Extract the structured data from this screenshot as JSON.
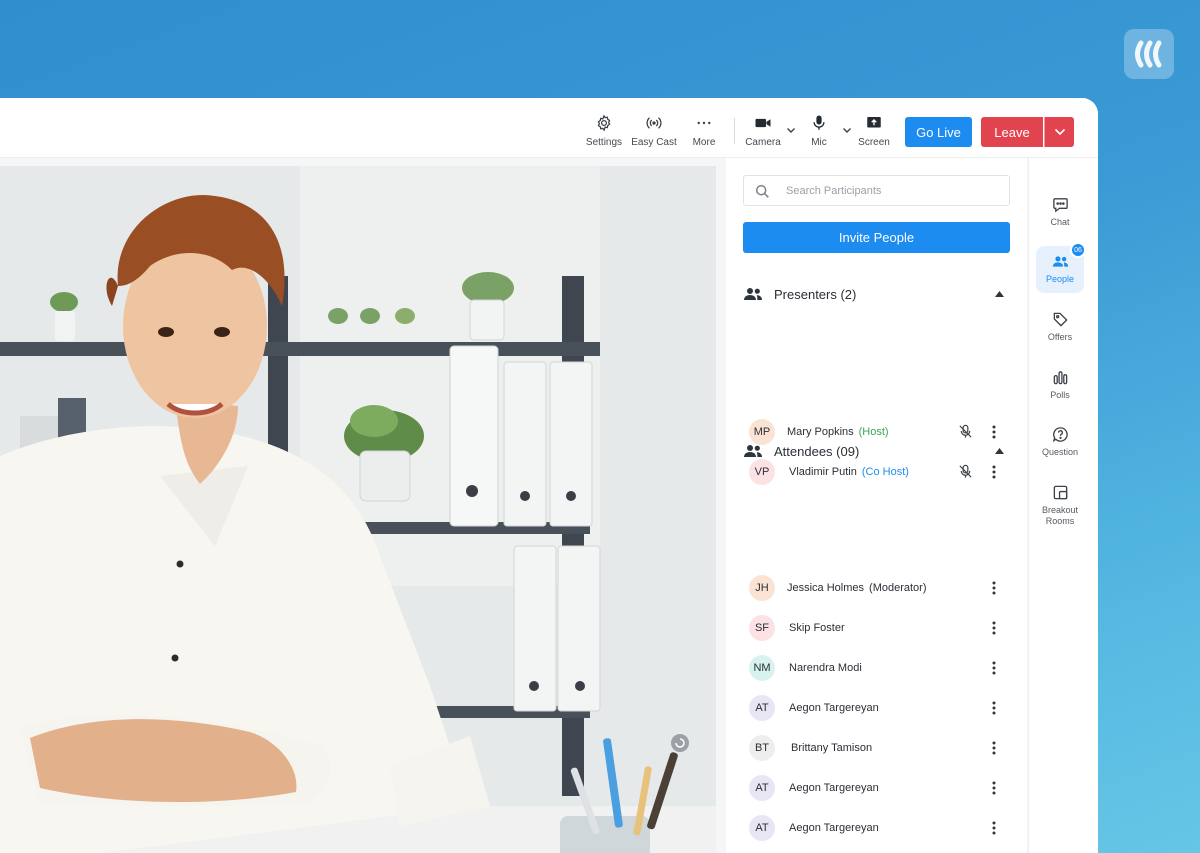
{
  "colors": {
    "primary": "#1c8cf0",
    "danger": "#e1434f",
    "host": "#3aa55d",
    "cohost": "#1c8cf0"
  },
  "toolbar": {
    "settings_label": "Settings",
    "easycast_label": "Easy Cast",
    "more_label": "More",
    "camera_label": "Camera",
    "mic_label": "Mic",
    "screen_label": "Screen",
    "golive_label": "Go Live",
    "leave_label": "Leave"
  },
  "participants": {
    "search_placeholder": "Search Participants",
    "invite_label": "Invite People",
    "presenters": {
      "title": "Presenters (2)",
      "items": [
        {
          "initials": "MP",
          "name": "Mary Popkins",
          "role": "(Host)",
          "avatar_color": "#fbe3d4",
          "muted": true
        },
        {
          "initials": "VP",
          "name": "Vladimir Putin",
          "role": "(Co Host)",
          "avatar_color": "#fde2e4",
          "muted": true
        }
      ]
    },
    "attendees": {
      "title": "Attendees (09)",
      "items": [
        {
          "initials": "JH",
          "name": "Jessica Holmes",
          "role": "(Moderator)",
          "avatar_color": "#fbe3d4"
        },
        {
          "initials": "SF",
          "name": "Skip Foster",
          "role": "",
          "avatar_color": "#fde2e4"
        },
        {
          "initials": "NM",
          "name": "Narendra Modi",
          "role": "",
          "avatar_color": "#d8f3ee"
        },
        {
          "initials": "AT",
          "name": "Aegon Targereyan",
          "role": "",
          "avatar_color": "#e9e5f5"
        },
        {
          "initials": "BT",
          "name": "Brittany Tamison",
          "role": "",
          "avatar_color": "#efeeee"
        },
        {
          "initials": "AT",
          "name": "Aegon Targereyan",
          "role": "",
          "avatar_color": "#e9e5f5"
        },
        {
          "initials": "AT",
          "name": "Aegon Targereyan",
          "role": "",
          "avatar_color": "#e9e5f5"
        }
      ]
    }
  },
  "sidenav": {
    "chat": "Chat",
    "people": "People",
    "people_badge": "06",
    "offers": "Offers",
    "polls": "Polls",
    "question": "Question",
    "breakout_line1": "Breakout",
    "breakout_line2": "Rooms"
  }
}
